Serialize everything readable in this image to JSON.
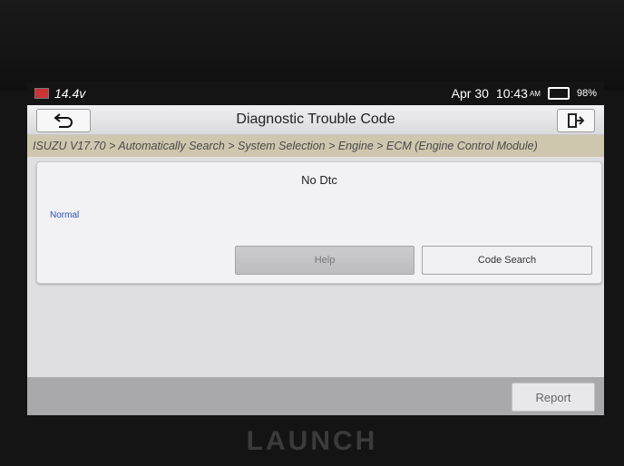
{
  "statusbar": {
    "voltage": "14.4v",
    "date": "Apr 30",
    "time": "10:43",
    "ampm": "AM",
    "battery_pct": "98%"
  },
  "header": {
    "title": "Diagnostic Trouble Code",
    "back_icon": "back-arrow-icon",
    "exit_icon": "exit-icon"
  },
  "breadcrumb": "ISUZU V17.70 > Automatically Search > System Selection > Engine > ECM (Engine Control Module)",
  "panel": {
    "dtc_status": "No Dtc",
    "state": "Normal",
    "help_label": "Help",
    "code_search_label": "Code Search"
  },
  "footer": {
    "report_label": "Report"
  },
  "brand": "LAUNCH",
  "colors": {
    "breadcrumb_bg": "#cfc6ae",
    "normal_text": "#2b4fc2"
  }
}
